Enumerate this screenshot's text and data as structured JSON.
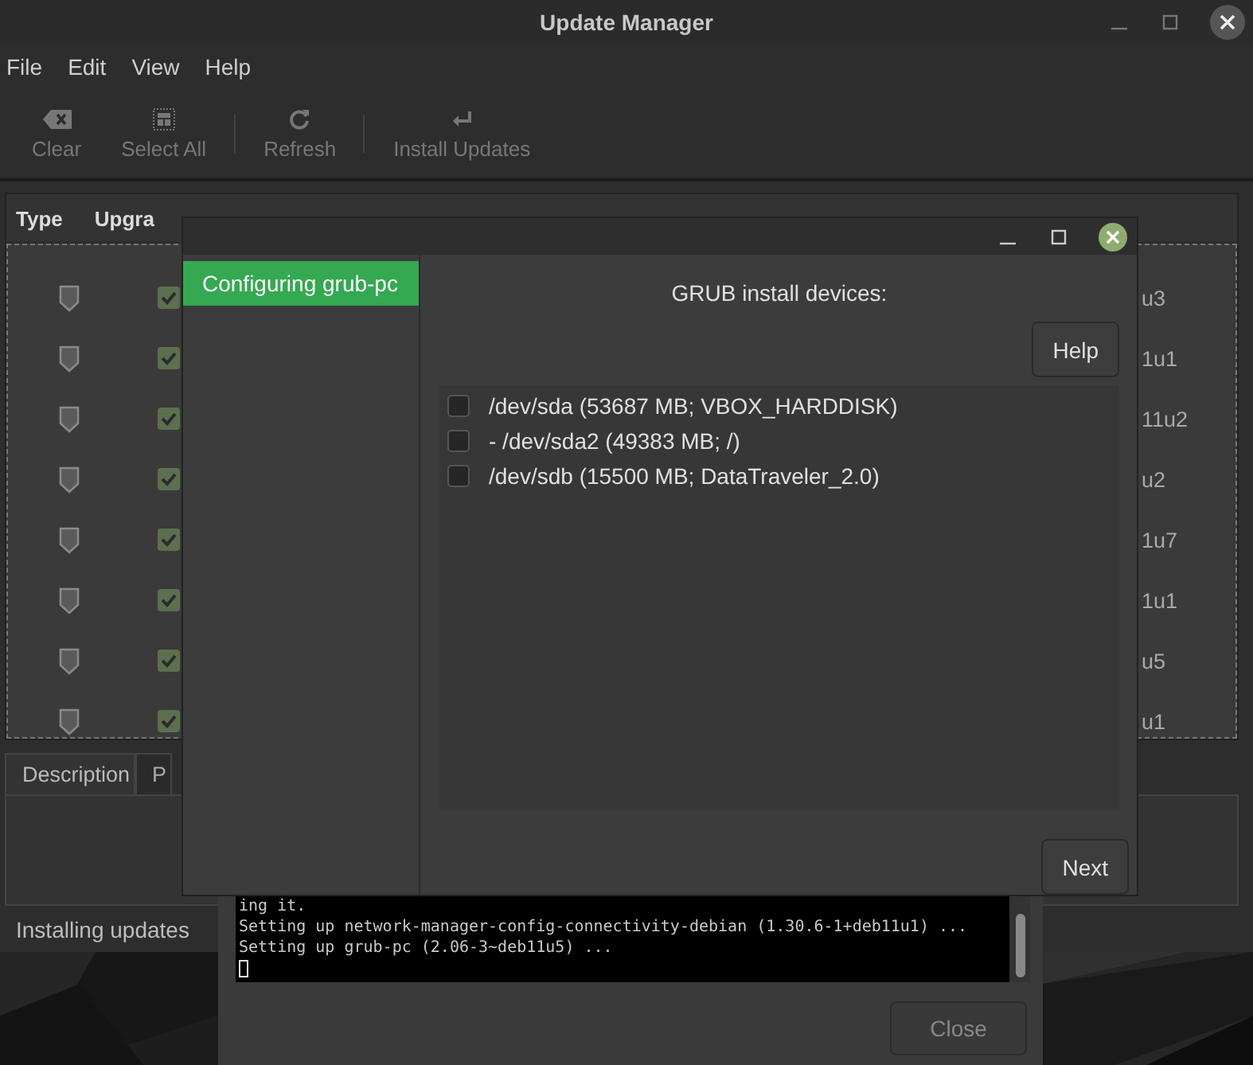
{
  "window": {
    "title": "Update Manager"
  },
  "menu": [
    "File",
    "Edit",
    "View",
    "Help"
  ],
  "toolbar": [
    {
      "kind": "clear",
      "label": "Clear",
      "disabled": true
    },
    {
      "kind": "select",
      "label": "Select All",
      "disabled": true
    },
    {
      "kind": "separator"
    },
    {
      "kind": "refresh",
      "label": "Refresh",
      "disabled": true
    },
    {
      "kind": "separator"
    },
    {
      "kind": "install",
      "label": "Install Updates",
      "disabled": true
    }
  ],
  "table": {
    "columns": [
      "Type",
      "Upgra"
    ],
    "rows": [
      {
        "upgrade": true,
        "column_3": "u3"
      },
      {
        "upgrade": true,
        "column_3": "1u1"
      },
      {
        "upgrade": true,
        "column_3": "11u2"
      },
      {
        "upgrade": true,
        "column_3": "u2"
      },
      {
        "upgrade": true,
        "column_3": "1u7"
      },
      {
        "upgrade": true,
        "column_3": "1u1"
      },
      {
        "upgrade": true,
        "column_3": "u5"
      },
      {
        "upgrade": true,
        "column_3": "u1"
      }
    ]
  },
  "tabs": [
    {
      "label": "Description",
      "selected": true
    },
    {
      "label": "P",
      "selected": false
    }
  ],
  "status": "Installing updates",
  "terminal": {
    "lines": [
      "ing it.",
      "Setting up network-manager-config-connectivity-debian (1.30.6-1+deb11u1) ...",
      "Setting up grub-pc (2.06-3~deb11u5) ..."
    ],
    "close_button": {
      "label": "Close",
      "disabled": true
    }
  },
  "dialog": {
    "sidebar": [
      {
        "label": "Configuring grub-pc",
        "selected": true
      }
    ],
    "heading": "GRUB install devices:",
    "help_button": "Help",
    "devices": [
      {
        "label": "/dev/sda (53687 MB; VBOX_HARDDISK)",
        "checked": false
      },
      {
        "label": "- /dev/sda2 (49383 MB; /)",
        "checked": false
      },
      {
        "label": "/dev/sdb (15500 MB; DataTraveler_2.0)",
        "checked": false
      }
    ],
    "next_button": "Next"
  }
}
